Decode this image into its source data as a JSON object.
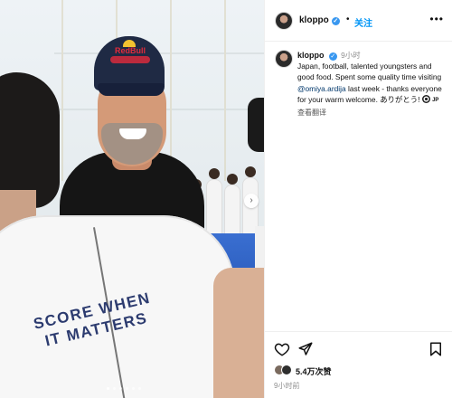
{
  "post": {
    "photo": {
      "cap_text": "RedBull",
      "vest_text": "SCORE WHEN\nIT MATTERS",
      "next_icon": "chevron-right-icon",
      "carousel_dots": 6,
      "carousel_active": 1
    },
    "header": {
      "username": "kloppo",
      "verified": true,
      "separator": "•",
      "follow_label": "关注",
      "more_label": "•••"
    },
    "caption": {
      "username": "kloppo",
      "time": "9小时",
      "text_before": "Japan, football, talented youngsters and good food. Spent some quality time visiting ",
      "mention": "@omiya.ardija",
      "text_after": " last week - thanks everyone for your warm welcome. ありがとう! ",
      "flag_text": "JP",
      "translate_label": "查看翻译"
    },
    "actions": {
      "like_icon": "heart-icon",
      "share_icon": "send-icon",
      "save_icon": "bookmark-icon",
      "likes_label": "5.4万次赞",
      "timestamp": "9小时前"
    },
    "colors": {
      "link_blue": "#0095f6",
      "mention_blue": "#00376b",
      "verified_blue": "#3897f0",
      "muted": "#8e8e8e"
    }
  }
}
